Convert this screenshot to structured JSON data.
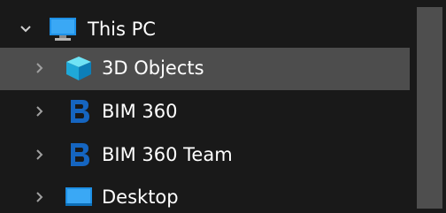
{
  "tree": {
    "items": [
      {
        "label": "This PC",
        "expanded": true,
        "icon": "computer-icon"
      },
      {
        "label": "3D Objects",
        "expanded": false,
        "icon": "cube-3d-icon",
        "selected": true
      },
      {
        "label": "BIM 360",
        "expanded": false,
        "icon": "bim360-b-icon"
      },
      {
        "label": "BIM 360 Team",
        "expanded": false,
        "icon": "bim360-b-icon"
      },
      {
        "label": "Desktop",
        "expanded": false,
        "icon": "desktop-folder-icon"
      }
    ]
  },
  "colors": {
    "background": "#191919",
    "selected_row": "#4d4d4d",
    "scrollbar_thumb": "#4e4e4e",
    "accent_blue": "#1e90e6",
    "bim_blue": "#1565c0"
  }
}
